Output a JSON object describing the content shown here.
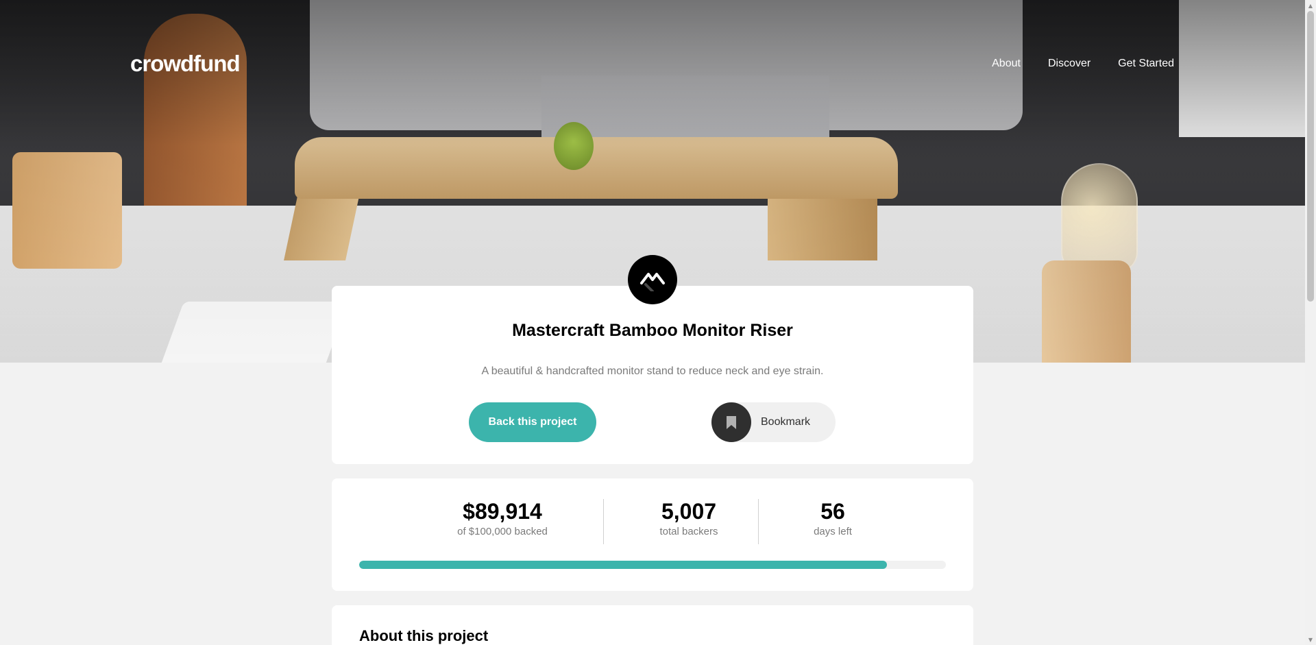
{
  "header": {
    "logo": "crowdfund",
    "nav": [
      "About",
      "Discover",
      "Get Started"
    ]
  },
  "project": {
    "title": "Mastercraft Bamboo Monitor Riser",
    "description": "A beautiful & handcrafted monitor stand to reduce neck and eye strain.",
    "back_button": "Back this project",
    "bookmark_button": "Bookmark"
  },
  "stats": {
    "backed_amount": "$89,914",
    "backed_label": "of $100,000 backed",
    "backers": "5,007",
    "backers_label": "total backers",
    "days": "56",
    "days_label": "days left",
    "progress_fraction": 0.899
  },
  "about": {
    "title": "About this project"
  },
  "colors": {
    "accent": "#3cb4ac",
    "dark": "#2f2f2f",
    "page_background": "#f2f2f2"
  },
  "icons": {
    "project_logo": "mastercraft-logo-icon",
    "bookmark": "bookmark-icon"
  }
}
